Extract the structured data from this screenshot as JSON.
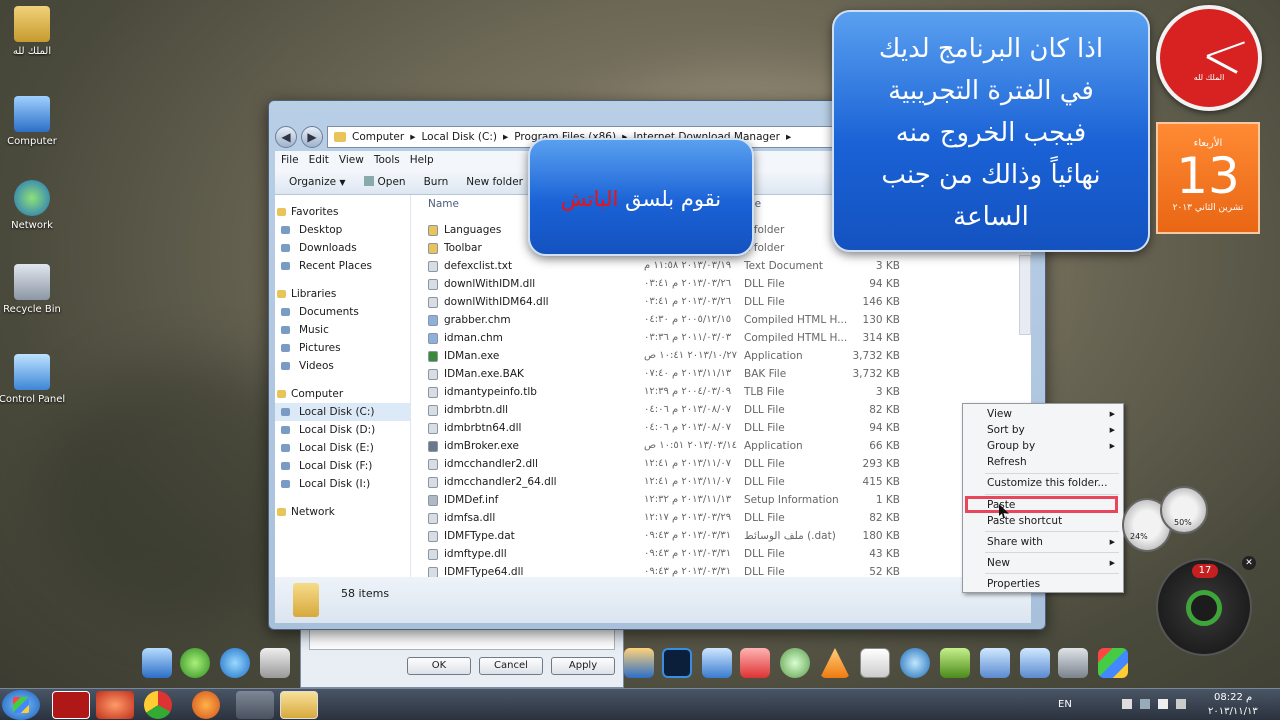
{
  "desktop_icons": [
    {
      "label": "الملك لله"
    },
    {
      "label": "Computer"
    },
    {
      "label": "Network"
    },
    {
      "label": "Recycle Bin"
    },
    {
      "label": "Control Panel"
    }
  ],
  "explorer": {
    "breadcrumb": [
      "Computer",
      "Local Disk (C:)",
      "Program Files (x86)",
      "Internet Download Manager"
    ],
    "menu": [
      "File",
      "Edit",
      "View",
      "Tools",
      "Help"
    ],
    "toolbar": [
      "Organize",
      "Open",
      "Burn",
      "New folder"
    ],
    "nav": [
      {
        "label": "Favorites",
        "head": true
      },
      {
        "label": "Desktop"
      },
      {
        "label": "Downloads"
      },
      {
        "label": "Recent Places"
      },
      {
        "label": "Libraries",
        "head": true
      },
      {
        "label": "Documents"
      },
      {
        "label": "Music"
      },
      {
        "label": "Pictures"
      },
      {
        "label": "Videos"
      },
      {
        "label": "Computer",
        "head": true
      },
      {
        "label": "Local Disk (C:)",
        "selected": true
      },
      {
        "label": "Local Disk (D:)"
      },
      {
        "label": "Local Disk (E:)"
      },
      {
        "label": "Local Disk (F:)"
      },
      {
        "label": "Local Disk (I:)"
      },
      {
        "label": "Network",
        "head": true
      }
    ],
    "column_header": "Name",
    "type_column_header": "pe",
    "files": [
      {
        "name": "Languages",
        "date": "",
        "type": "e folder",
        "size": "",
        "icon": "folder"
      },
      {
        "name": "Toolbar",
        "date": "",
        "type": "e folder",
        "size": "",
        "icon": "folder"
      },
      {
        "name": "defexclist.txt",
        "date": "٢٠١٣/٠٣/١٩ ١١:٥٨ م",
        "type": "Text Document",
        "size": "3 KB",
        "icon": "file"
      },
      {
        "name": "downlWithIDM.dll",
        "date": "٢٠١٣/٠٣/٢٦ م ٠٣:٤١",
        "type": "DLL File",
        "size": "94 KB",
        "icon": "file"
      },
      {
        "name": "downlWithIDM64.dll",
        "date": "٢٠١٣/٠٣/٢٦ م ٠٣:٤١",
        "type": "DLL File",
        "size": "146 KB",
        "icon": "file"
      },
      {
        "name": "grabber.chm",
        "date": "٢٠٠٥/١٢/١٥ م ٠٤:٣٠",
        "type": "Compiled HTML H...",
        "size": "130 KB",
        "icon": "chm"
      },
      {
        "name": "idman.chm",
        "date": "٢٠١١/٠٣/٠٣ م ٠٣:٣٦",
        "type": "Compiled HTML H...",
        "size": "314 KB",
        "icon": "chm"
      },
      {
        "name": "IDMan.exe",
        "date": "٢٠١٣/١٠/٢٧ ١٠:٤١ ص",
        "type": "Application",
        "size": "3,732 KB",
        "icon": "exe"
      },
      {
        "name": "IDMan.exe.BAK",
        "date": "٢٠١٣/١١/١٣ م ٠٧:٤٠",
        "type": "BAK File",
        "size": "3,732 KB",
        "icon": "file"
      },
      {
        "name": "idmantypeinfo.tlb",
        "date": "٢٠٠٤/٠٣/٠٩ م ١٢:٣٩",
        "type": "TLB File",
        "size": "3 KB",
        "icon": "file"
      },
      {
        "name": "idmbrbtn.dll",
        "date": "٢٠١٣/٠٨/٠٧ م ٠٤:٠٦",
        "type": "DLL File",
        "size": "82 KB",
        "icon": "file"
      },
      {
        "name": "idmbrbtn64.dll",
        "date": "٢٠١٣/٠٨/٠٧ م ٠٤:٠٦",
        "type": "DLL File",
        "size": "94 KB",
        "icon": "file"
      },
      {
        "name": "idmBroker.exe",
        "date": "٢٠١٣/٠٣/١٤ ١٠:٥١ ص",
        "type": "Application",
        "size": "66 KB",
        "icon": "broker"
      },
      {
        "name": "idmcchandler2.dll",
        "date": "٢٠١٣/١١/٠٧ م ١٢:٤١",
        "type": "DLL File",
        "size": "293 KB",
        "icon": "file"
      },
      {
        "name": "idmcchandler2_64.dll",
        "date": "٢٠١٣/١١/٠٧ م ١٢:٤١",
        "type": "DLL File",
        "size": "415 KB",
        "icon": "file"
      },
      {
        "name": "IDMDef.inf",
        "date": "٢٠١٣/١١/١٣ م ١٢:٣٢",
        "type": "Setup Information",
        "size": "1 KB",
        "icon": "inf"
      },
      {
        "name": "idmfsa.dll",
        "date": "٢٠١٣/٠٣/٢٩ م ١٢:١٧",
        "type": "DLL File",
        "size": "82 KB",
        "icon": "file"
      },
      {
        "name": "IDMFType.dat",
        "date": "٢٠١٣/٠٣/٣١ م ٠٩:٤٣",
        "type": "ملف الوسائط (.dat)",
        "size": "180 KB",
        "icon": "file"
      },
      {
        "name": "idmftype.dll",
        "date": "٢٠١٣/٠٣/٣١ م ٠٩:٤٣",
        "type": "DLL File",
        "size": "43 KB",
        "icon": "file"
      },
      {
        "name": "IDMFType64.dll",
        "date": "٢٠١٣/٠٣/٣١ م ٠٩:٤٣",
        "type": "DLL File",
        "size": "52 KB",
        "icon": "file"
      }
    ],
    "status": "58 items"
  },
  "dialog": {
    "ok": "OK",
    "cancel": "Cancel",
    "apply": "Apply"
  },
  "overlay_small": {
    "text_before": "نقوم بلسق",
    "text_red": "الباتش"
  },
  "overlay_big": {
    "lines": [
      "اذا كان البرنامج لديك",
      "في الفترة التجريبية",
      "فيجب الخروج منه",
      "نهائياً وذالك من جنب",
      "الساعة"
    ]
  },
  "context_menu": {
    "items": [
      {
        "label": "View",
        "submenu": true
      },
      {
        "label": "Sort by",
        "submenu": true
      },
      {
        "label": "Group by",
        "submenu": true
      },
      {
        "label": "Refresh",
        "submenu": false
      },
      {
        "label": "Customize this folder...",
        "submenu": false
      },
      {
        "label": "Paste",
        "submenu": false
      },
      {
        "label": "Paste shortcut",
        "submenu": false
      },
      {
        "label": "Share with",
        "submenu": true
      },
      {
        "label": "New",
        "submenu": true
      },
      {
        "label": "Properties",
        "submenu": false
      }
    ]
  },
  "gadgets": {
    "clock_label": "الملك لله",
    "calendar_day_name": "الأربعاء",
    "calendar_day": "13",
    "calendar_month_year": "تشرين الثاني ٢٠١٣",
    "cpu_percent": "24%",
    "mem_percent": "50%",
    "badge_count": "17"
  },
  "taskbar": {
    "lang": "EN",
    "time": "08:22 م",
    "date": "٢٠١٣/١١/١٣"
  },
  "colors": {
    "accent_blue": "#1a62d6",
    "highlight_red": "#e8465a",
    "calendar_orange": "#e96614",
    "clock_red": "#d82222"
  }
}
